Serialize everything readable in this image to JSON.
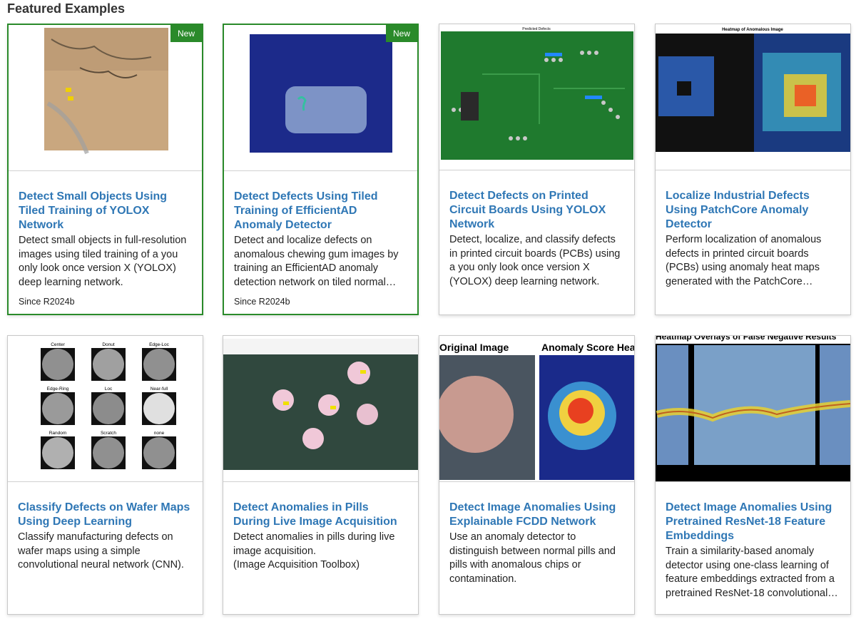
{
  "section": {
    "title": "Featured Examples"
  },
  "cards": [
    {
      "title": "Detect Small Objects Using Tiled Training of YOLOX Network",
      "description": "Detect small objects in full-resolution images using tiled training of a you only look once version X (YOLOX) deep learning network.",
      "badge": "New",
      "since": "Since R2024b"
    },
    {
      "title": "Detect Defects Using Tiled Training of EfficientAD Anomaly Detector",
      "description": "Detect and localize defects on anomalous chewing gum images by training an EfficientAD anomaly detection network on tiled normal…",
      "badge": "New",
      "since": "Since R2024b"
    },
    {
      "title": "Detect Defects on Printed Circuit Boards Using YOLOX Network",
      "description": "Detect, localize, and classify defects in printed circuit boards (PCBs) using a you only look once version X (YOLOX) deep learning network.",
      "image_caption": "Predicted Defects"
    },
    {
      "title": "Localize Industrial Defects Using PatchCore Anomaly Detector",
      "description": "Perform localization of anomalous defects in printed circuit boards (PCBs) using anomaly heat maps generated with the PatchCore…",
      "image_caption": "Heatmap of Anomalous Image"
    },
    {
      "title": "Classify Defects on Wafer Maps Using Deep Learning",
      "description": "Classify manufacturing defects on wafer maps using a simple convolutional neural network (CNN).",
      "image_labels": [
        "Center",
        "Donut",
        "Edge-Loc",
        "Edge-Ring",
        "Loc",
        "Near-full",
        "Random",
        "Scratch",
        "none"
      ]
    },
    {
      "title": "Detect Anomalies in Pills During Live Image Acquisition",
      "description": "Detect anomalies in pills during live image acquisition.",
      "description_extra": "(Image Acquisition Toolbox)"
    },
    {
      "title": "Detect Image Anomalies Using Explainable FCDD Network",
      "description": "Use an anomaly detector to distinguish between normal pills and pills with anomalous chips or contamination.",
      "image_labels": [
        "Original Image",
        "Anomaly Score Hea"
      ]
    },
    {
      "title": "Detect Image Anomalies Using Pretrained ResNet-18 Feature Embeddings",
      "description": "Train a similarity-based anomaly detector using one-class learning of feature embeddings extracted from a pretrained ResNet-18 convolutional…",
      "image_caption": "Heatmap Overlays of False Negative Results"
    }
  ],
  "colors": {
    "link": "#2f77b5",
    "featured_border": "#2a8a2a",
    "badge_bg": "#2a8a2a"
  }
}
